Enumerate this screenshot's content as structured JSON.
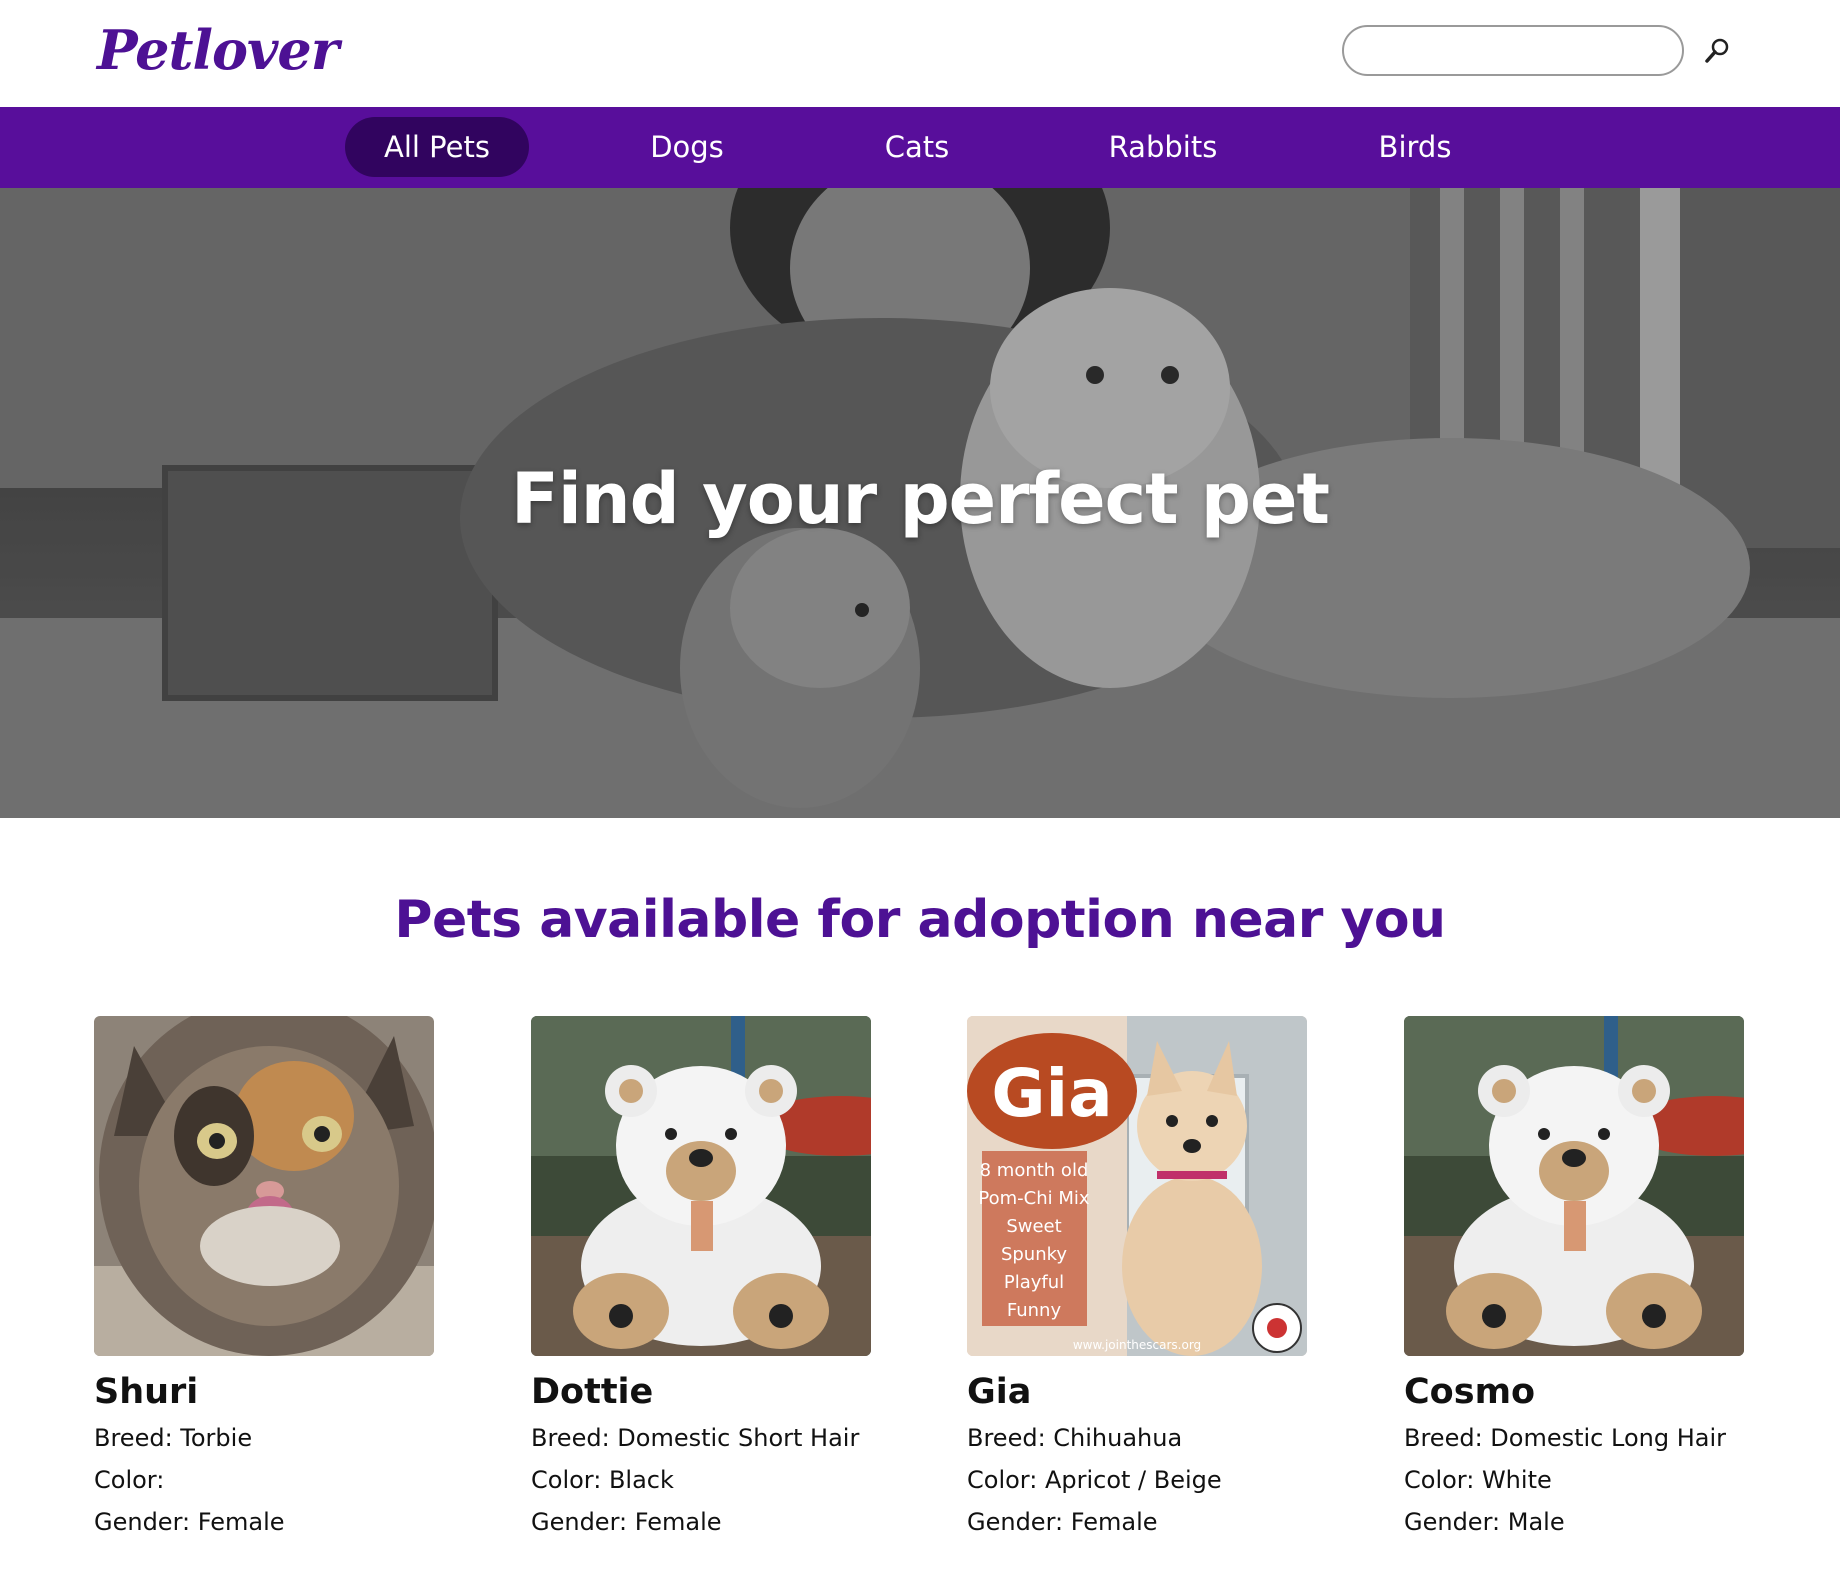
{
  "brand": {
    "logo": "Petlover",
    "accent": "#580e9b",
    "accent_dark": "#31045f",
    "title_color": "#4d1194"
  },
  "search": {
    "placeholder": "",
    "value": "",
    "icon": "search-icon"
  },
  "nav": {
    "items": [
      {
        "label": "All Pets",
        "active": true
      },
      {
        "label": "Dogs",
        "active": false
      },
      {
        "label": "Cats",
        "active": false
      },
      {
        "label": "Rabbits",
        "active": false
      },
      {
        "label": "Birds",
        "active": false
      }
    ]
  },
  "hero": {
    "title": "Find your perfect pet"
  },
  "section": {
    "title": "Pets available for adoption near you"
  },
  "pets": [
    {
      "name": "Shuri",
      "breed": "Breed: Torbie",
      "color": "Color:",
      "gender": "Gender: Female",
      "photo": "calico-cat-photo"
    },
    {
      "name": "Dottie",
      "breed": "Breed: Domestic Short Hair",
      "color": "Color: Black",
      "gender": "Gender: Female",
      "photo": "teddy-bear-photo"
    },
    {
      "name": "Gia",
      "breed": "Breed: Chihuahua",
      "color": "Color: Apricot / Beige",
      "gender": "Gender: Female",
      "photo": "dog-flyer-photo",
      "flyer": {
        "title": "Gia",
        "lines": [
          "8 month old",
          "Pom-Chi Mix",
          "Sweet",
          "Spunky",
          "Playful",
          "Funny"
        ],
        "url": "www.jointhescars.org"
      }
    },
    {
      "name": "Cosmo",
      "breed": "Breed: Domestic Long Hair",
      "color": "Color: White",
      "gender": "Gender: Male",
      "photo": "teddy-bear-photo"
    }
  ]
}
